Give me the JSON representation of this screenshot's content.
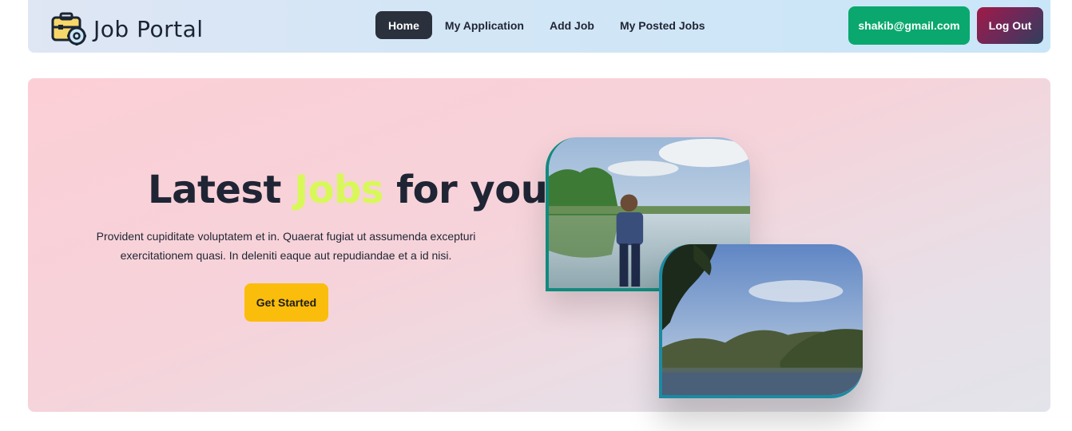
{
  "header": {
    "brand": "Job Portal",
    "nav": [
      {
        "label": "Home",
        "active": true
      },
      {
        "label": "My Application",
        "active": false
      },
      {
        "label": "Add Job",
        "active": false
      },
      {
        "label": "My Posted Jobs",
        "active": false
      }
    ],
    "user_email": "shakib@gmail.com",
    "logout_label": "Log Out"
  },
  "hero": {
    "title_before": "Latest ",
    "title_accent": "Jobs",
    "title_after": " for you!",
    "description": "Provident cupiditate voluptatem et in. Quaerat fugiat ut assumenda excepturi exercitationem quasi. In deleniti eaque aut repudiandae et a id nisi.",
    "cta_label": "Get Started"
  },
  "colors": {
    "accent": "#d8f85a",
    "cta": "#fbbd0b",
    "user_button": "#0aa86e",
    "active_nav": "#2a303c"
  }
}
